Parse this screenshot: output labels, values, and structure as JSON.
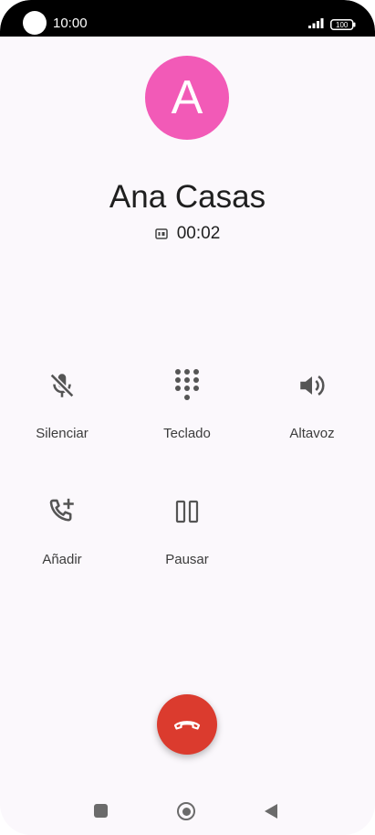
{
  "status_bar": {
    "time": "10:00",
    "battery": "100"
  },
  "call": {
    "avatar_letter": "A",
    "caller_name": "Ana Casas",
    "timer": "00:02",
    "avatar_color": "#f25ab7"
  },
  "actions": {
    "mute": {
      "label": "Silenciar",
      "icon": "mic-off-icon"
    },
    "keypad": {
      "label": "Teclado",
      "icon": "dialpad-icon"
    },
    "speaker": {
      "label": "Altavoz",
      "icon": "speaker-icon"
    },
    "add_call": {
      "label": "Añadir",
      "icon": "add-call-icon"
    },
    "hold": {
      "label": "Pausar",
      "icon": "pause-icon"
    }
  },
  "end_call": {
    "icon": "call-end-icon",
    "color": "#db3b2e"
  },
  "nav_bar": {
    "recent": "recent-apps-icon",
    "home": "home-icon",
    "back": "back-icon"
  }
}
